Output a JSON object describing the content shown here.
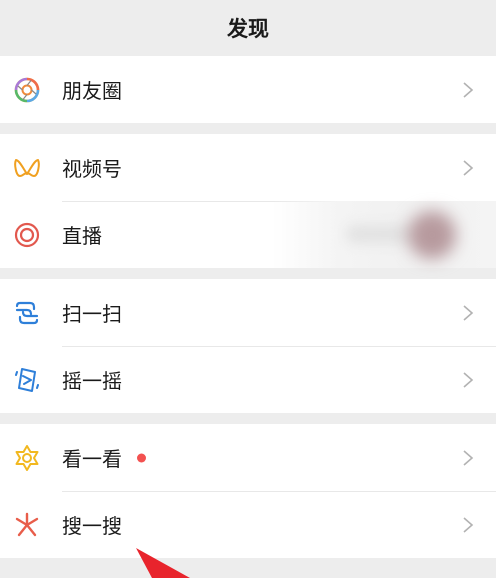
{
  "header": {
    "title": "发现"
  },
  "groups": [
    {
      "items": [
        {
          "label": "朋友圈",
          "icon": "moments-icon"
        }
      ]
    },
    {
      "items": [
        {
          "label": "视频号",
          "icon": "channels-icon"
        },
        {
          "label": "直播",
          "icon": "live-icon"
        }
      ]
    },
    {
      "items": [
        {
          "label": "扫一扫",
          "icon": "scan-icon"
        },
        {
          "label": "摇一摇",
          "icon": "shake-icon"
        }
      ]
    },
    {
      "items": [
        {
          "label": "看一看",
          "icon": "top-stories-icon",
          "badge": "red-dot"
        },
        {
          "label": "搜一搜",
          "icon": "search-icon"
        }
      ]
    }
  ],
  "colors": {
    "background": "#ededed",
    "row": "#ffffff",
    "badge": "#f35150",
    "pointer": "#e8242c"
  }
}
